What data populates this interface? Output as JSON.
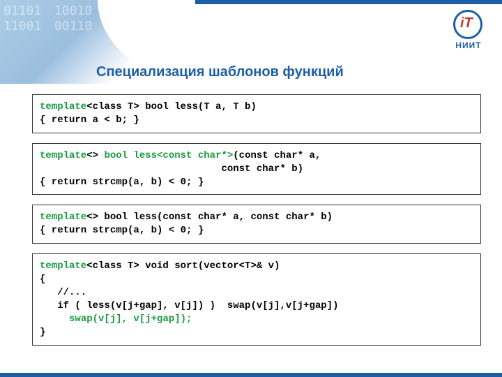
{
  "logo": {
    "icon_text": "iT",
    "label": "НИИТ"
  },
  "title": "Специализация шаблонов функций",
  "code_blocks": [
    [
      {
        "t": "template",
        "c": "green"
      },
      {
        "t": "<class T> bool less(T a, T b)\n{ return a < b; }",
        "c": "black"
      }
    ],
    [
      {
        "t": "template",
        "c": "green"
      },
      {
        "t": "<> ",
        "c": "black"
      },
      {
        "t": "bool less<const char*>",
        "c": "green"
      },
      {
        "t": "(const char* a,\n                               const char* b)\n{ return strcmp(a, b) < 0; }",
        "c": "black"
      }
    ],
    [
      {
        "t": "template",
        "c": "green"
      },
      {
        "t": "<> bool less(const char* a, const char* b)\n{ return strcmp(a, b) < 0; }",
        "c": "black"
      }
    ],
    [
      {
        "t": "template",
        "c": "green"
      },
      {
        "t": "<class T> void sort(vector<T>& v)\n{\n   //...\n   if ( less(v[j+gap], v[j]) )  swap(v[j],v[j+gap])\n     ",
        "c": "black"
      },
      {
        "t": "swap(v[j], v[j+gap]);",
        "c": "green"
      },
      {
        "t": "\n}",
        "c": "black"
      }
    ]
  ]
}
